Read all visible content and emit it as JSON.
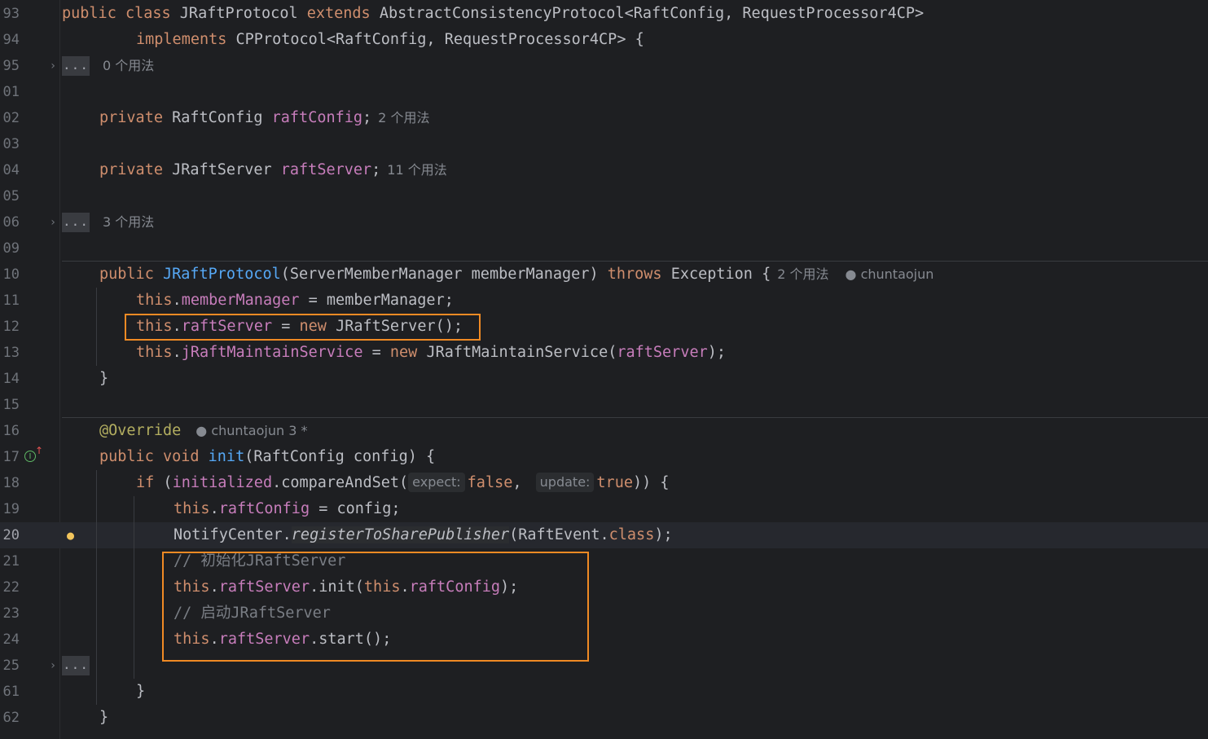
{
  "editor": {
    "file_class": "JRaftProtocol",
    "line_numbers": [
      "93",
      "94",
      "95",
      "01",
      "02",
      "03",
      "04",
      "05",
      "06",
      "09",
      "10",
      "11",
      "12",
      "13",
      "14",
      "15",
      "16",
      "17",
      "18",
      "19",
      "20",
      "21",
      "22",
      "23",
      "24",
      "25",
      "61",
      "62"
    ],
    "current_line": "20",
    "fold_placeholder": "...",
    "author": "chuntaojun",
    "author_badge": "chuntaojun 3 *",
    "usages": {
      "zero": "0 个用法",
      "two": "2 个用法",
      "eleven": "11 个用法",
      "three": "3 个用法"
    },
    "param_hints": {
      "expect": "expect:",
      "update": "update:"
    },
    "code": {
      "l93": {
        "kw1": "public class ",
        "cls": "JRaftProtocol ",
        "kw2": "extends ",
        "rest": "AbstractConsistencyProtocol<RaftConfig, RequestProcessor4CP>"
      },
      "l94": {
        "kw": "implements ",
        "rest": "CPProtocol<RaftConfig, RequestProcessor4CP> {"
      },
      "l02": {
        "kw": "private ",
        "type": "RaftConfig ",
        "field": "raftConfig",
        "end": ";"
      },
      "l04": {
        "kw": "private ",
        "type": "JRaftServer ",
        "field": "raftServer",
        "end": ";"
      },
      "l10": {
        "kw": "public ",
        "fn": "JRaftProtocol",
        "args": "(ServerMemberManager memberManager) ",
        "kw2": "throws ",
        "rest": "Exception {"
      },
      "l11": {
        "this": "this",
        "dot": ".",
        "field": "memberManager",
        "rest": " = memberManager;"
      },
      "l12": {
        "this": "this",
        "dot": ".",
        "field": "raftServer",
        "op": " = ",
        "kw": "new ",
        "rest": "JRaftServer();"
      },
      "l13": {
        "this": "this",
        "dot": ".",
        "field": "jRaftMaintainService",
        "op": " = ",
        "kw": "new ",
        "rest1": "JRaftMaintainService(",
        "arg": "raftServer",
        "rest2": ");"
      },
      "l14": {
        "rest": "}"
      },
      "l16": {
        "ann": "@Override"
      },
      "l17": {
        "kw": "public void ",
        "fn": "init",
        "rest": "(RaftConfig config) {"
      },
      "l18": {
        "kw": "if ",
        "p": "(",
        "field": "initialized",
        "call": ".compareAndSet(",
        "v1": "false",
        "comma": ", ",
        "v2": "true",
        "end": ")) {"
      },
      "l19": {
        "this": "this",
        "dot": ".",
        "field": "raftConfig",
        "rest": " = config;"
      },
      "l20": {
        "cls": "NotifyCenter.",
        "method": "registerToSharePublisher",
        "p": "(RaftEvent.",
        "kw": "class",
        "end": ");"
      },
      "l21": {
        "comment": "// 初始化JRaftServer"
      },
      "l22": {
        "this": "this",
        "dot": ".",
        "field": "raftServer",
        "call": ".init(",
        "this2": "this",
        "dot2": ".",
        "field2": "raftConfig",
        "end": ");"
      },
      "l23": {
        "comment": "// 启动JRaftServer"
      },
      "l24": {
        "this": "this",
        "dot": ".",
        "field": "raftServer",
        "rest": ".start();"
      },
      "l61": {
        "rest": "}"
      },
      "l62": {
        "rest": "}"
      }
    },
    "colors": {
      "background": "#1e1f22",
      "keyword": "#cf8e6d",
      "field": "#c77dbb",
      "function": "#56a8f5",
      "annotation": "#b3ae60",
      "comment": "#7a7e85",
      "highlight_box": "#f08a24"
    }
  }
}
